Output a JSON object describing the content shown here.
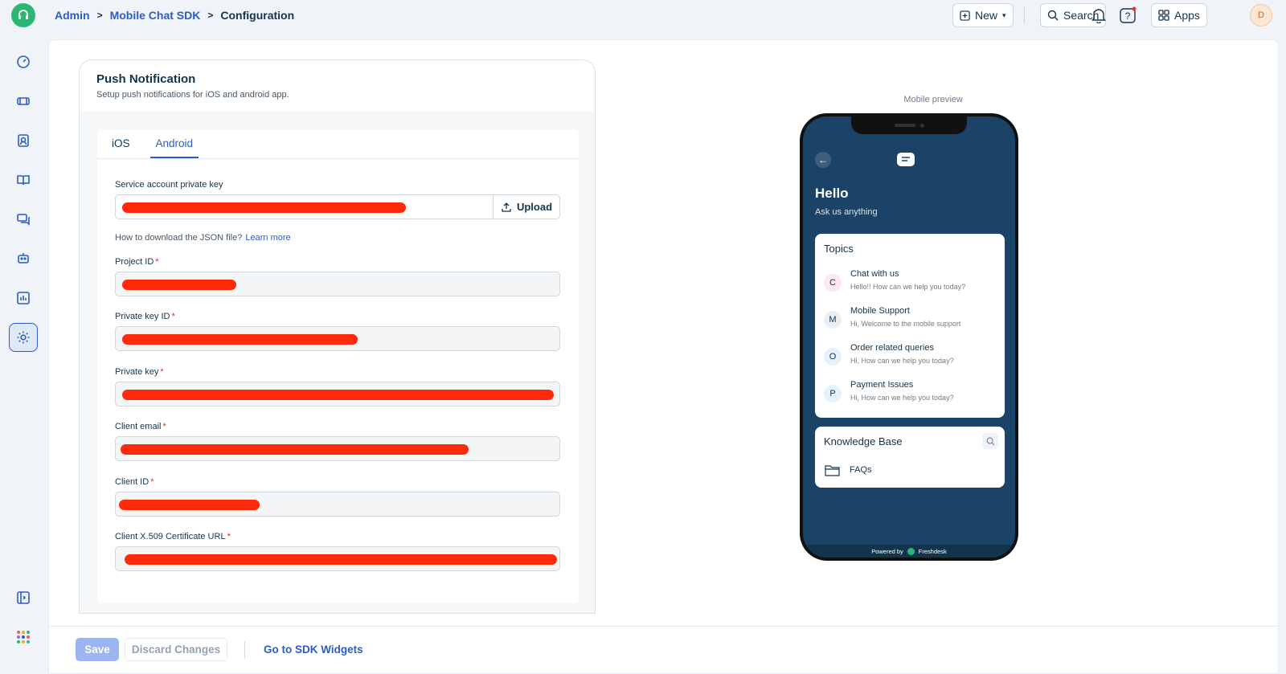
{
  "breadcrumb": {
    "admin": "Admin",
    "sdk": "Mobile Chat SDK",
    "current": "Configuration"
  },
  "topbar": {
    "new_label": "New",
    "search_label": "Search",
    "apps_label": "Apps",
    "avatar_initial": "D"
  },
  "card": {
    "title": "Push Notification",
    "subtitle": "Setup push notifications for iOS and android app.",
    "tabs": [
      {
        "label": "iOS",
        "active": false
      },
      {
        "label": "Android",
        "active": true
      }
    ],
    "fields": {
      "service_key_label": "Service account private key",
      "upload_label": "Upload",
      "help_text": "How to download the JSON file?",
      "learn_more": "Learn more",
      "project_id_label": "Project ID",
      "private_key_id_label": "Private key ID",
      "private_key_label": "Private key",
      "client_email_label": "Client email",
      "client_id_label": "Client ID",
      "cert_url_label": "Client X.509 Certificate URL",
      "required_mark": "*"
    }
  },
  "footer": {
    "save": "Save",
    "discard": "Discard Changes",
    "sdk_widgets": "Go to SDK Widgets"
  },
  "preview": {
    "label": "Mobile preview",
    "hello": "Hello",
    "ask": "Ask us anything",
    "topics_title": "Topics",
    "topics": [
      {
        "initial": "C",
        "name": "Chat with us",
        "sub": "Hello!! How can we help you today?",
        "badge_color": "#fde8ec"
      },
      {
        "initial": "M",
        "name": "Mobile Support",
        "sub": "Hi, Welcome to the mobile support",
        "badge_color": "#ebeff3"
      },
      {
        "initial": "O",
        "name": "Order related queries",
        "sub": "Hi, How can we help you today?",
        "badge_color": "#e5f2fd"
      },
      {
        "initial": "P",
        "name": "Payment Issues",
        "sub": "Hi, How can we help you today?",
        "badge_color": "#e5f2fd"
      }
    ],
    "kb_title": "Knowledge Base",
    "kb_item": "FAQs",
    "powered_by": "Powered by",
    "brand": "Freshdesk"
  },
  "colors": {
    "accent": "#2c5cc5",
    "redaction": "#ff2a0a",
    "phone_bg": "#1b4367"
  }
}
